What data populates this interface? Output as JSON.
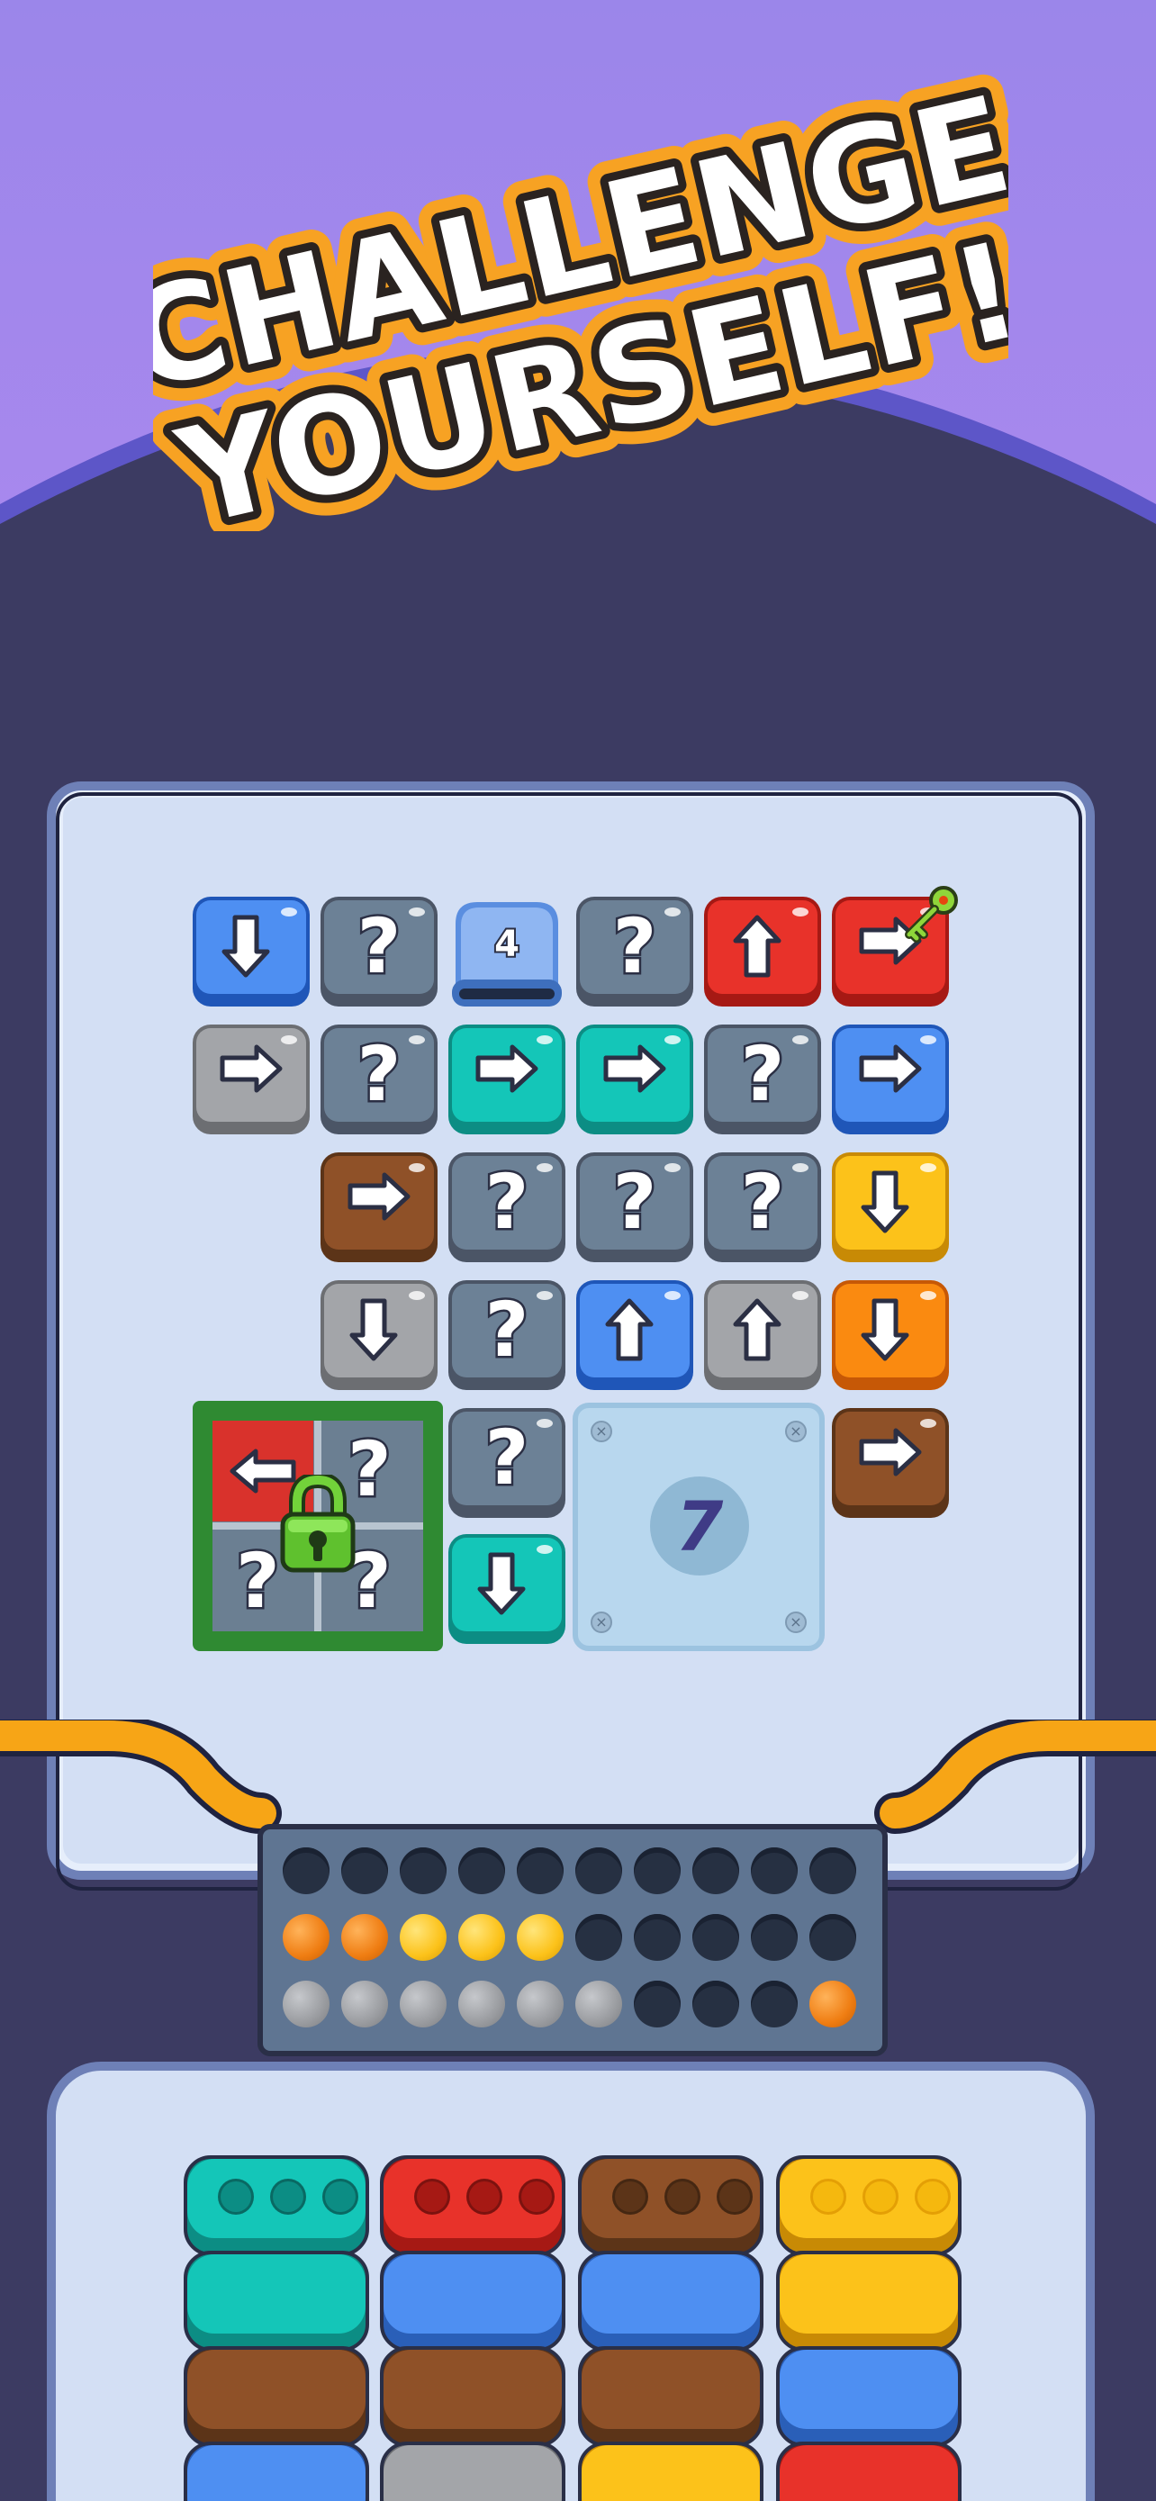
{
  "header": {
    "title_line1": "CHALLENGE",
    "title_line2": "YOURSELF!"
  },
  "colors": {
    "sky": "#a086ec",
    "background": "#3c3b62",
    "board": "#d3dff4",
    "board_border": "#6e80b7",
    "title_fill": "#ffffff",
    "title_stroke": "#f7a223"
  },
  "board": {
    "tiles": [
      {
        "row": 1,
        "col": 1,
        "color": "blue",
        "content": "arrow-down"
      },
      {
        "row": 1,
        "col": 2,
        "color": "gray",
        "content": "?"
      },
      {
        "row": 1,
        "col": 3,
        "color": "light-blue-slot",
        "content": "4"
      },
      {
        "row": 1,
        "col": 4,
        "color": "gray",
        "content": "?"
      },
      {
        "row": 1,
        "col": 5,
        "color": "red",
        "content": "arrow-up"
      },
      {
        "row": 1,
        "col": 6,
        "color": "red",
        "content": "arrow-right",
        "extra": "key"
      },
      {
        "row": 2,
        "col": 1,
        "color": "light-gray",
        "content": "arrow-right"
      },
      {
        "row": 2,
        "col": 2,
        "color": "gray",
        "content": "?"
      },
      {
        "row": 2,
        "col": 3,
        "color": "teal",
        "content": "arrow-right"
      },
      {
        "row": 2,
        "col": 4,
        "color": "teal",
        "content": "arrow-right"
      },
      {
        "row": 2,
        "col": 5,
        "color": "gray",
        "content": "?"
      },
      {
        "row": 2,
        "col": 6,
        "color": "blue",
        "content": "arrow-right"
      },
      {
        "row": 3,
        "col": 2,
        "color": "brown",
        "content": "arrow-right"
      },
      {
        "row": 3,
        "col": 3,
        "color": "gray",
        "content": "?"
      },
      {
        "row": 3,
        "col": 4,
        "color": "gray",
        "content": "?"
      },
      {
        "row": 3,
        "col": 5,
        "color": "gray",
        "content": "?"
      },
      {
        "row": 3,
        "col": 6,
        "color": "yellow",
        "content": "arrow-down"
      },
      {
        "row": 4,
        "col": 2,
        "color": "light-gray",
        "content": "arrow-down"
      },
      {
        "row": 4,
        "col": 3,
        "color": "gray",
        "content": "?"
      },
      {
        "row": 4,
        "col": 4,
        "color": "blue",
        "content": "arrow-up"
      },
      {
        "row": 4,
        "col": 5,
        "color": "light-gray",
        "content": "arrow-up"
      },
      {
        "row": 4,
        "col": 6,
        "color": "orange",
        "content": "arrow-down"
      },
      {
        "row": 5,
        "col": 3,
        "color": "gray",
        "content": "?"
      },
      {
        "row": 5,
        "col": 6,
        "color": "brown",
        "content": "arrow-right"
      },
      {
        "row": 6,
        "col": 3,
        "color": "teal",
        "content": "arrow-down"
      }
    ],
    "slot_count": "4",
    "question_mark": "?",
    "locked_block": {
      "marks": [
        "?",
        "?",
        "?"
      ],
      "arrow": "arrow-left",
      "icon": "padlock-icon"
    },
    "counter": "7"
  },
  "tray": {
    "rows": [
      [
        "empty",
        "empty",
        "empty",
        "empty",
        "empty",
        "empty",
        "empty",
        "empty",
        "empty",
        "empty"
      ],
      [
        "orange",
        "orange",
        "yellow",
        "yellow",
        "yellow",
        "empty",
        "empty",
        "empty",
        "empty",
        "empty"
      ],
      [
        "gray",
        "gray",
        "gray",
        "gray",
        "gray",
        "gray",
        "empty",
        "empty",
        "empty",
        "orange"
      ]
    ]
  },
  "stacks": [
    [
      "teal",
      "teal",
      "brown",
      "blue"
    ],
    [
      "red",
      "blue",
      "brown",
      "gray"
    ],
    [
      "brown",
      "blue",
      "brown",
      "yellow"
    ],
    [
      "yellow",
      "yellow",
      "blue",
      "red"
    ]
  ]
}
